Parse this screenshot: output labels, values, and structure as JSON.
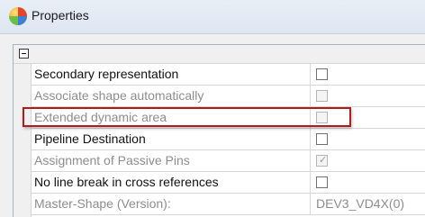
{
  "window": {
    "title": "Properties",
    "app_icon": "app-logo-icon"
  },
  "panel": {
    "collapse_icon": "collapse-minus-icon",
    "rows": [
      {
        "label": "Secondary representation",
        "type": "checkbox",
        "checked": false,
        "enabled": true
      },
      {
        "label": "Associate shape automatically",
        "type": "checkbox",
        "checked": false,
        "enabled": false
      },
      {
        "label": "Extended dynamic area",
        "type": "checkbox",
        "checked": false,
        "enabled": false,
        "highlighted": true
      },
      {
        "label": "Pipeline Destination",
        "type": "checkbox",
        "checked": false,
        "enabled": true
      },
      {
        "label": "Assignment of Passive Pins",
        "type": "checkbox",
        "checked": true,
        "enabled": false
      },
      {
        "label": "No line break in cross references",
        "type": "checkbox",
        "checked": false,
        "enabled": true
      },
      {
        "label": "Master-Shape (Version):",
        "type": "text",
        "value": "DEV3_VD4X(0)",
        "enabled": false
      }
    ]
  },
  "colors": {
    "highlight_border": "#b01c1c",
    "disabled_text": "#8d8d8d"
  }
}
